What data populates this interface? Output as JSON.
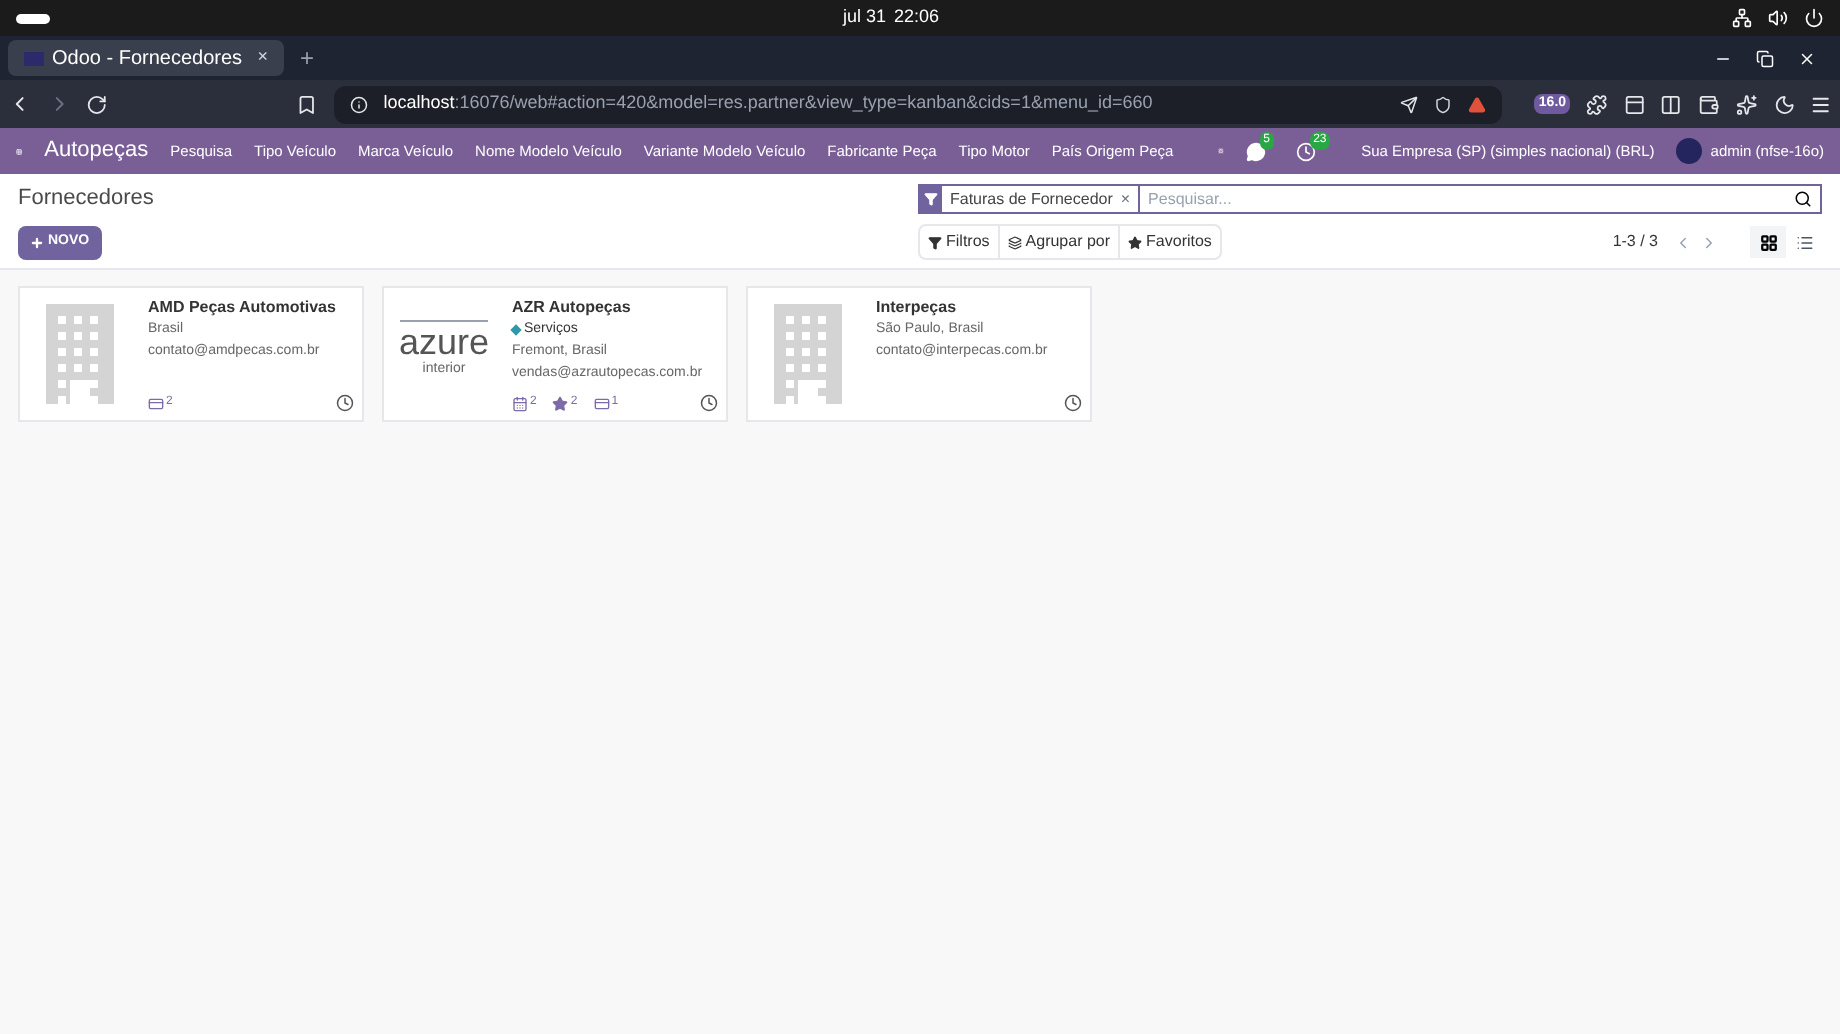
{
  "system_bar": {
    "date": "jul 31",
    "time": "22:06"
  },
  "browser": {
    "tab_title": "Odoo - Fornecedores",
    "tab_close": "×",
    "new_tab": "+",
    "url_host": "localhost",
    "url_rest": ":16076/web#action=420&model=res.partner&view_type=kanban&cids=1&menu_id=660",
    "extension_badge": "16.0"
  },
  "navbar": {
    "app": "Autopeças",
    "menu": [
      "Pesquisa",
      "Tipo Veículo",
      "Marca Veículo",
      "Nome Modelo Veículo",
      "Variante Modelo Veículo",
      "Fabricante Peça",
      "Tipo Motor",
      "País Origem Peça"
    ],
    "messages_count": "5",
    "activities_count": "23",
    "company": "Sua Empresa (SP) (simples nacional) (BRL)",
    "user": "admin (nfse-16o)"
  },
  "control_panel": {
    "title": "Fornecedores",
    "new_button": "NOVO",
    "facet": "Faturas de Fornecedor",
    "facet_remove": "×",
    "search_placeholder": "Pesquisar...",
    "filters": "Filtros",
    "group_by": "Agrupar por",
    "favorites": "Favoritos",
    "pager": "1-3 / 3",
    "views": [
      {
        "kind": "kanban",
        "selected": true
      },
      {
        "kind": "list",
        "selected": false
      }
    ]
  },
  "cards": [
    {
      "name": "AMD Peças Automotivas",
      "avatar": {
        "kind": "building"
      },
      "location": "Brasil",
      "email": "contato@amdpecas.com.br",
      "counters": [
        {
          "kind": "card",
          "count": "2"
        }
      ]
    },
    {
      "name": "AZR Autopeças",
      "avatar": {
        "kind": "logo",
        "text": "azure",
        "subtext": "interior"
      },
      "tag": {
        "label": "Serviços",
        "color": "#2e9aa8"
      },
      "location": "Fremont, Brasil",
      "email": "vendas@azrautopecas.com.br",
      "counters": [
        {
          "kind": "calendar",
          "count": "2"
        },
        {
          "kind": "star",
          "count": "2"
        },
        {
          "kind": "card",
          "count": "1"
        }
      ]
    },
    {
      "name": "Interpeças",
      "avatar": {
        "kind": "building"
      },
      "location": "São Paulo, Brasil",
      "email": "contato@interpecas.com.br"
    }
  ]
}
